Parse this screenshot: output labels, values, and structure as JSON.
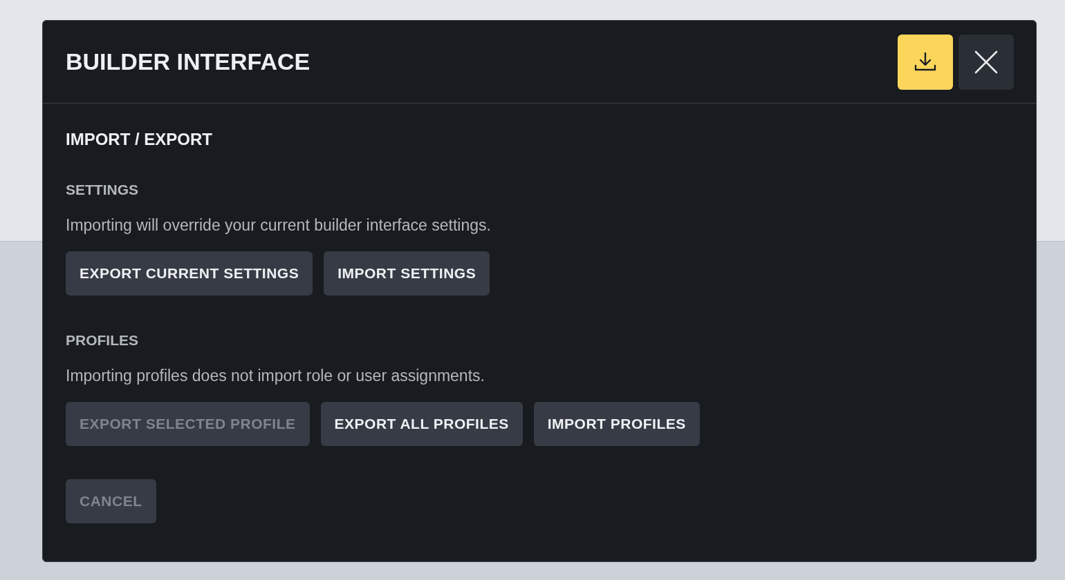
{
  "dialog": {
    "title": "BUILDER INTERFACE",
    "section_title": "IMPORT / EXPORT",
    "groups": [
      {
        "label": "SETTINGS",
        "description": "Importing will override your current builder interface settings.",
        "buttons": [
          {
            "label": "EXPORT CURRENT SETTINGS",
            "disabled": false
          },
          {
            "label": "IMPORT SETTINGS",
            "disabled": false
          }
        ]
      },
      {
        "label": "PROFILES",
        "description": "Importing profiles does not import role or user assignments.",
        "buttons": [
          {
            "label": "EXPORT SELECTED PROFILE",
            "disabled": true
          },
          {
            "label": "EXPORT ALL PROFILES",
            "disabled": false
          },
          {
            "label": "IMPORT PROFILES",
            "disabled": false
          }
        ]
      }
    ],
    "cancel": {
      "label": "CANCEL",
      "disabled": true
    }
  }
}
